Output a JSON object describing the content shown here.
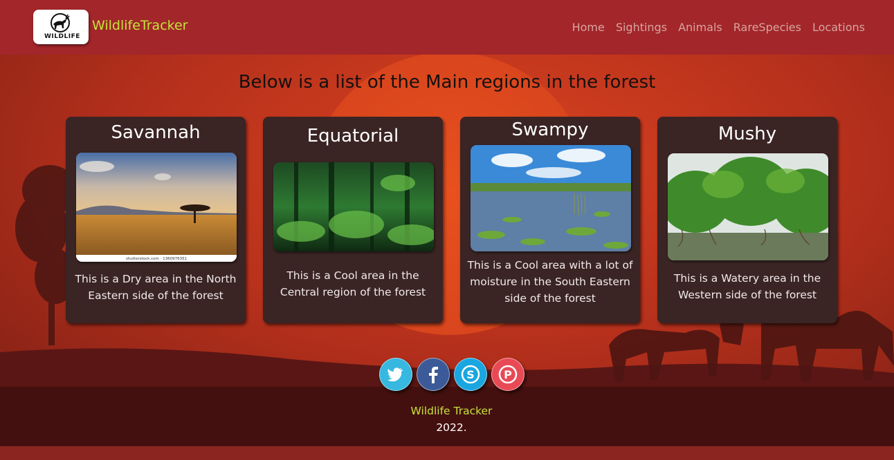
{
  "navbar": {
    "logo_text": "WILDLIFE",
    "brand": "WildlifeTracker",
    "links": [
      "Home",
      "Sightings",
      "Animals",
      "RareSpecies",
      "Locations"
    ]
  },
  "page_title": "Below is a list of the Main regions in the forest",
  "cards": [
    {
      "title": "Savannah",
      "text": "This is a Dry area in the North Eastern side of the forest",
      "image_caption": "shutterstock.com · 1360976351"
    },
    {
      "title": "Equatorial",
      "text": "This is a Cool area in the Central region of the forest"
    },
    {
      "title": "Swampy",
      "text": "This is a Cool area with a lot of moisture in the South Eastern side of the forest"
    },
    {
      "title": "Mushy",
      "text": "This is a Watery area in the Western side of the forest"
    }
  ],
  "socials": [
    "twitter-icon",
    "facebook-icon",
    "skype-icon",
    "pinterest-icon"
  ],
  "footer": {
    "name": "Wildlife Tracker",
    "year": "2022."
  },
  "colors": {
    "navbar": "#a2262a",
    "brand": "#c6e33b",
    "card": "#3a2424",
    "footer_name": "#c6e33b"
  }
}
